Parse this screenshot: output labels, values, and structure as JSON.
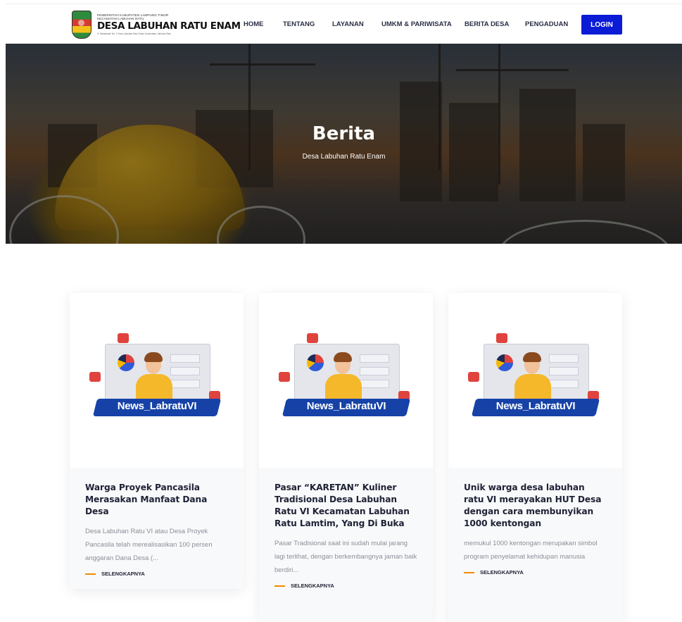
{
  "header": {
    "logo_line1": "PEMERINTAH KABUPATEN LAMPUNG TIMUR",
    "logo_line2": "KECAMATAN LABUHAN RATU",
    "logo_title": "DESA LABUHAN RATU ENAM",
    "logo_address": "Jl. Wanasantri No. 1 Desa Labuhan Ratu Enam Kecamatan Labuhan Ratu",
    "nav": [
      "HOME",
      "TENTANG",
      "LAYANAN",
      "UMKM & PARIWISATA",
      "BERITA DESA",
      "PENGADUAN"
    ],
    "login_label": "LOGIN"
  },
  "hero": {
    "title": "Berita",
    "subtitle": "Desa Labuhan Ratu Enam"
  },
  "cards": [
    {
      "image_label": "News_LabratuVI",
      "title": "Warga Proyek Pancasila Merasakan Manfaat Dana Desa",
      "excerpt": "Desa Labuhan Ratu VI atau Desa Proyek Pancasila telah merealisasikan 100 persen anggaran Dana Desa (...",
      "more_label": "SELENGKAPNYA"
    },
    {
      "image_label": "News_LabratuVI",
      "title": "Pasar “KARETAN” Kuliner Tradisional Desa Labuhan Ratu VI Kecamatan Labuhan Ratu Lamtim, Yang Di Buka",
      "excerpt": "Pasar Tradisional saat ini sudah mulai jarang lagi terlihat, dengan berkembangnya jaman baik berdiri...",
      "more_label": "SELENGKAPNYA"
    },
    {
      "image_label": "News_LabratuVI",
      "title": "Unik warga desa labuhan ratu VI merayakan HUT Desa dengan cara membunyikan 1000 kentongan",
      "excerpt": "memukul 1000 kentongan merupakan simbol program penyelamat kehidupan manusia",
      "more_label": "SELENGKAPNYA"
    }
  ],
  "colors": {
    "accent": "#0b1bd6",
    "link_line": "#f08a00",
    "heading": "#1e2235"
  }
}
